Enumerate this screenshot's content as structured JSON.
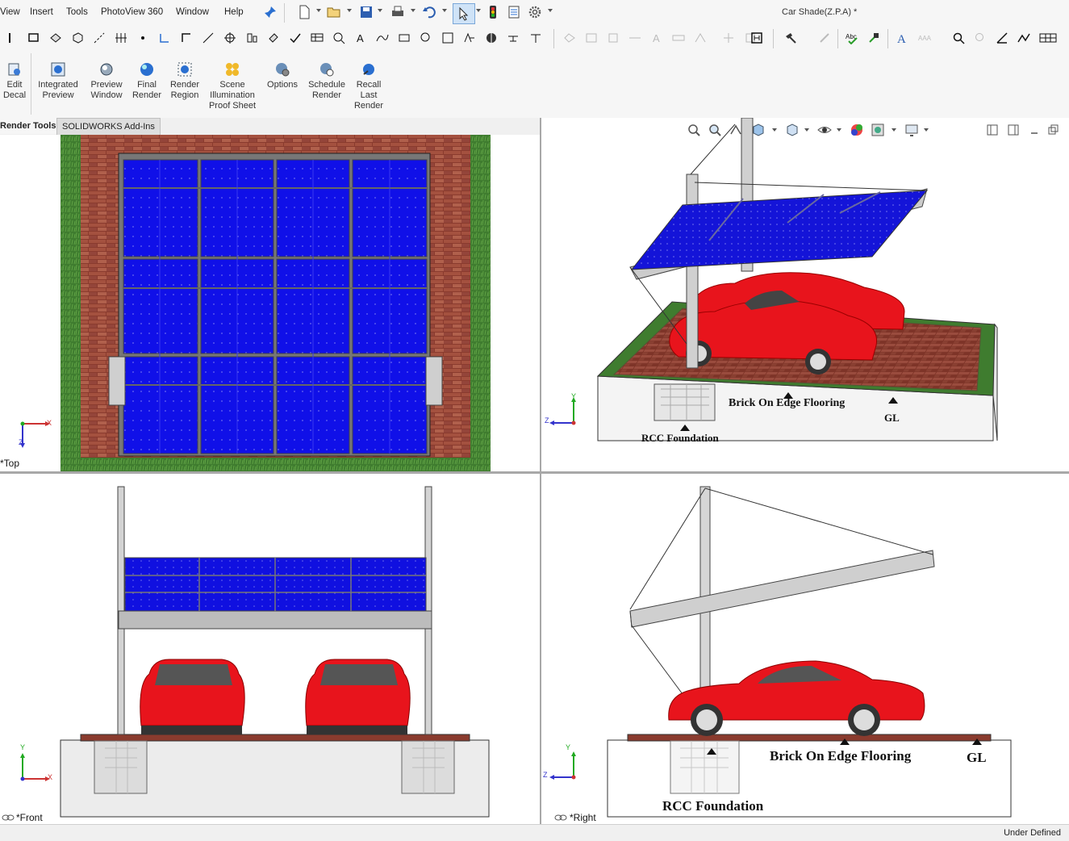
{
  "menu": {
    "items": [
      "View",
      "Insert",
      "Tools",
      "PhotoView 360",
      "Window",
      "Help"
    ],
    "view_label": "View",
    "insert_label": "Insert",
    "tools_label": "Tools",
    "photoview_label": "PhotoView 360",
    "window_label": "Window",
    "help_label": "Help"
  },
  "window": {
    "title": "Car Shade(Z.P.A) *"
  },
  "commands": {
    "edit_decal": "Edit Decal",
    "integrated_preview": "Integrated Preview",
    "preview_window": "Preview Window",
    "final_render": "Final Render",
    "render_region": "Render Region",
    "scene_illumination": "Scene Illumination Proof Sheet",
    "options": "Options",
    "schedule_render": "Schedule Render",
    "recall_last_render": "Recall Last Render"
  },
  "tabs": {
    "render_tools": "Render Tools",
    "addins": "SOLIDWORKS Add-Ins"
  },
  "viewports": {
    "top": "*Top",
    "front": "*Front",
    "right": "*Right"
  },
  "annotations": {
    "brick": "Brick On Edge Flooring",
    "gl": "GL",
    "rcc": "RCC Foundation"
  },
  "triad": {
    "x": "X",
    "y": "Y",
    "z": "Z"
  },
  "status": {
    "text": "Under Defined"
  },
  "colors": {
    "panel": "#1a1ae6",
    "car": "#e8141c",
    "brick": "#8a3a2a",
    "grass": "#3a7a2a",
    "steel": "#d8d8d8"
  }
}
